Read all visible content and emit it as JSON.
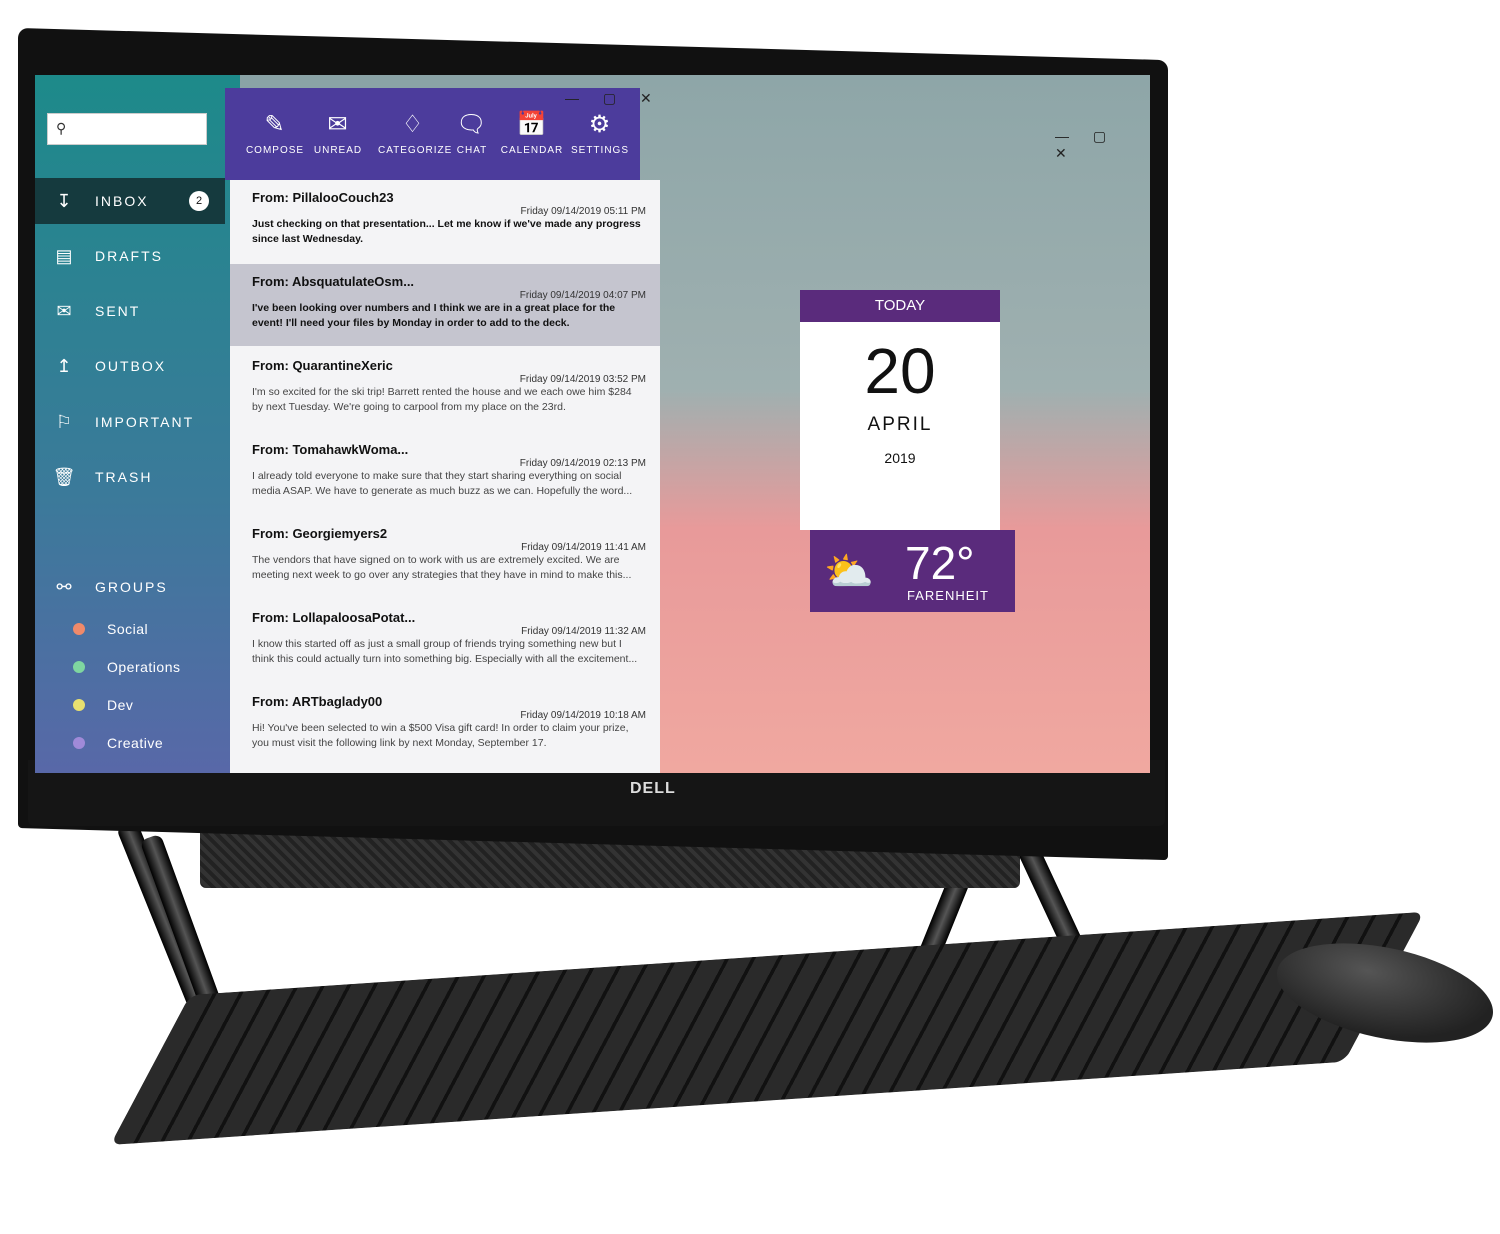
{
  "brand": "DELL",
  "sidebar": {
    "search_placeholder": "",
    "items": [
      {
        "label": "INBOX",
        "icon": "inbox-icon",
        "badge": "2"
      },
      {
        "label": "DRAFTS",
        "icon": "drafts-icon"
      },
      {
        "label": "SENT",
        "icon": "sent-icon"
      },
      {
        "label": "OUTBOX",
        "icon": "outbox-icon"
      },
      {
        "label": "IMPORTANT",
        "icon": "flag-icon"
      },
      {
        "label": "TRASH",
        "icon": "trash-icon"
      }
    ],
    "groups_label": "GROUPS",
    "groups": [
      {
        "label": "Social",
        "color": "#f08a6a"
      },
      {
        "label": "Operations",
        "color": "#7fd6a0"
      },
      {
        "label": "Dev",
        "color": "#e8e070"
      },
      {
        "label": "Creative",
        "color": "#a08ad8"
      }
    ]
  },
  "toolbar": [
    {
      "label": "COMPOSE",
      "icon": "pencil-icon"
    },
    {
      "label": "UNREAD",
      "icon": "envelope-icon"
    },
    {
      "label": "CATEGORIZE",
      "icon": "tag-icon"
    },
    {
      "label": "CHAT",
      "icon": "chat-icon"
    },
    {
      "label": "CALENDAR",
      "icon": "calendar-icon"
    },
    {
      "label": "SETTINGS",
      "icon": "gear-icon"
    }
  ],
  "emails": [
    {
      "from": "From: PillalooCouch23",
      "date": "Friday 09/14/2019 05:11 PM",
      "body": "Just checking on that presentation... Let me know if we've made any progress since last Wednesday.",
      "unread": true
    },
    {
      "from": "From: AbsquatulateOsm...",
      "date": "Friday 09/14/2019 04:07 PM",
      "body": "I've been looking over numbers and I think we are in a great place for the event! I'll need your files by Monday in order to add to the deck.",
      "unread": true,
      "selected": true
    },
    {
      "from": "From: QuarantineXeric",
      "date": "Friday 09/14/2019 03:52 PM",
      "body": "I'm so excited for the ski trip! Barrett rented the house and we each owe him $284 by next Tuesday. We're going to carpool from my place on the 23rd."
    },
    {
      "from": "From: TomahawkWoma...",
      "date": "Friday 09/14/2019 02:13 PM",
      "body": "I already told everyone to make sure that they start sharing everything on social media ASAP. We have to generate as much buzz as we can. Hopefully the word..."
    },
    {
      "from": "From: Georgiemyers2",
      "date": "Friday 09/14/2019 11:41 AM",
      "body": "The vendors that have signed on to work with us are extremely excited. We are meeting next week to go over any strategies that they have in mind to make this..."
    },
    {
      "from": "From: LollapaloosaPotat...",
      "date": "Friday 09/14/2019 11:32 AM",
      "body": "I know this started off as just a small group of friends trying something new but I think this could actually turn into something big. Especially with all the excitement..."
    },
    {
      "from": "From: ARTbaglady00",
      "date": "Friday 09/14/2019 10:18 AM",
      "body": "Hi! You've been selected to win a $500 Visa gift card! In order to claim your prize, you must visit the following link by next Monday, September 17."
    }
  ],
  "widget": {
    "header": "TODAY",
    "day": "20",
    "month": "APRIL",
    "year": "2019",
    "temp": "72°",
    "unit": "FARENHEIT",
    "weather_icon": "partly-cloudy-icon"
  },
  "window_controls": "— ▢ ✕"
}
